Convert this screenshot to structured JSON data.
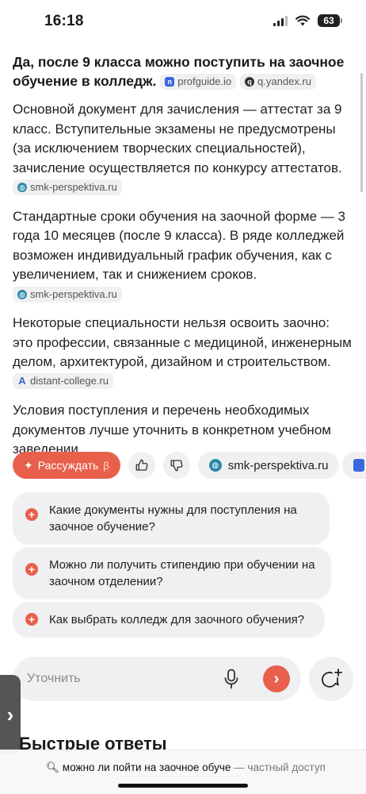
{
  "status_bar": {
    "time": "16:18",
    "battery": "63"
  },
  "answer": {
    "headline": "Да, после 9 класса можно поступить на заочное обучение в колледж.",
    "headline_sources": [
      "profguide.io",
      "q.yandex.ru"
    ],
    "paragraphs": [
      {
        "text": "Основной документ для зачисления — аттестат за 9 класс. Вступительные экзамены не предусмотрены (за исключением творческих специальностей), зачисление осуществляется по конкурсу аттестатов.",
        "source": "smk-perspektiva.ru"
      },
      {
        "text": "Стандартные сроки обучения на заочной форме — 3 года 10 месяцев (после 9 класса). В ряде колледжей возможен индивидуальный график обучения, как с увеличением, так и снижением сроков.",
        "source": "smk-perspektiva.ru"
      },
      {
        "text": "Некоторые специальности нельзя освоить заочно: это профессии, связанные с медициной, инженерным делом, архитектурой, дизайном и строительством.",
        "source": "distant-college.ru"
      },
      {
        "text": "Условия поступления и перечень необходимых документов лучше уточнить в конкретном учебном заведении.",
        "source": ""
      }
    ]
  },
  "actions": {
    "reason_label": "Рассуждать",
    "reason_beta": "β",
    "source_chip": "smk-perspektiva.ru"
  },
  "suggestions": [
    "Какие документы нужны для поступления на заочное обучение?",
    "Можно ли получить стипендию при обучении на заочном отделении?",
    "Как выбрать колледж для заочного обучения?"
  ],
  "input": {
    "placeholder": "Уточнить"
  },
  "quick_answers_title": "Быстрые ответы",
  "url_bar": {
    "query": "можно ли пойти на заочное обуче",
    "suffix": "— частный доступ"
  },
  "colors": {
    "accent": "#e8604c",
    "chip_bg": "#f0f0f3"
  }
}
